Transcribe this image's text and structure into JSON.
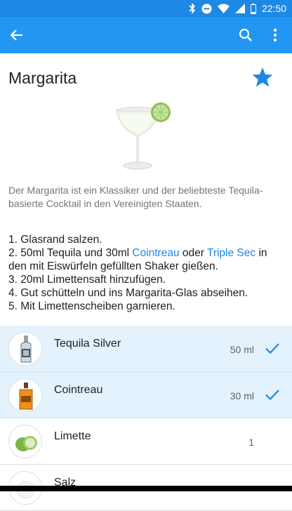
{
  "status": {
    "time": "22:50"
  },
  "appbar": {
    "back_icon": "arrow-back-icon",
    "search_icon": "search-icon",
    "menu_icon": "more-vert-icon"
  },
  "recipe": {
    "title": "Margarita",
    "favorite": true,
    "description": "Der Margarita ist ein Klassiker und der beliebteste Tequila-basierte Cocktail in den Vereinigten Staaten.",
    "steps": {
      "s1": "1. Glasrand salzen.",
      "s2_a": "2. 50ml Tequila und 30ml ",
      "s2_link1": "Cointreau",
      "s2_b": " oder ",
      "s2_link2": "Triple Sec",
      "s2_c": " in den mit Eiswürfeln gefüllten Shaker gießen.",
      "s3": "3. 20ml Limettensaft hinzufügen.",
      "s4": "4. Gut schütteln und ins Margarita-Glas abseihen.",
      "s5": "5. Mit Limettenscheiben garnieren."
    }
  },
  "ingredients": [
    {
      "name": "Tequila Silver",
      "amount": "50 ml",
      "owned": true
    },
    {
      "name": "Cointreau",
      "amount": "30 ml",
      "owned": true
    },
    {
      "name": "Limette",
      "amount": "1",
      "owned": false
    },
    {
      "name": "Salz",
      "amount": "",
      "owned": false
    }
  ],
  "colors": {
    "primary": "#2196f3",
    "status": "#1e88e5",
    "accent": "#1e88e5",
    "owned_row": "#e3f2fd"
  }
}
